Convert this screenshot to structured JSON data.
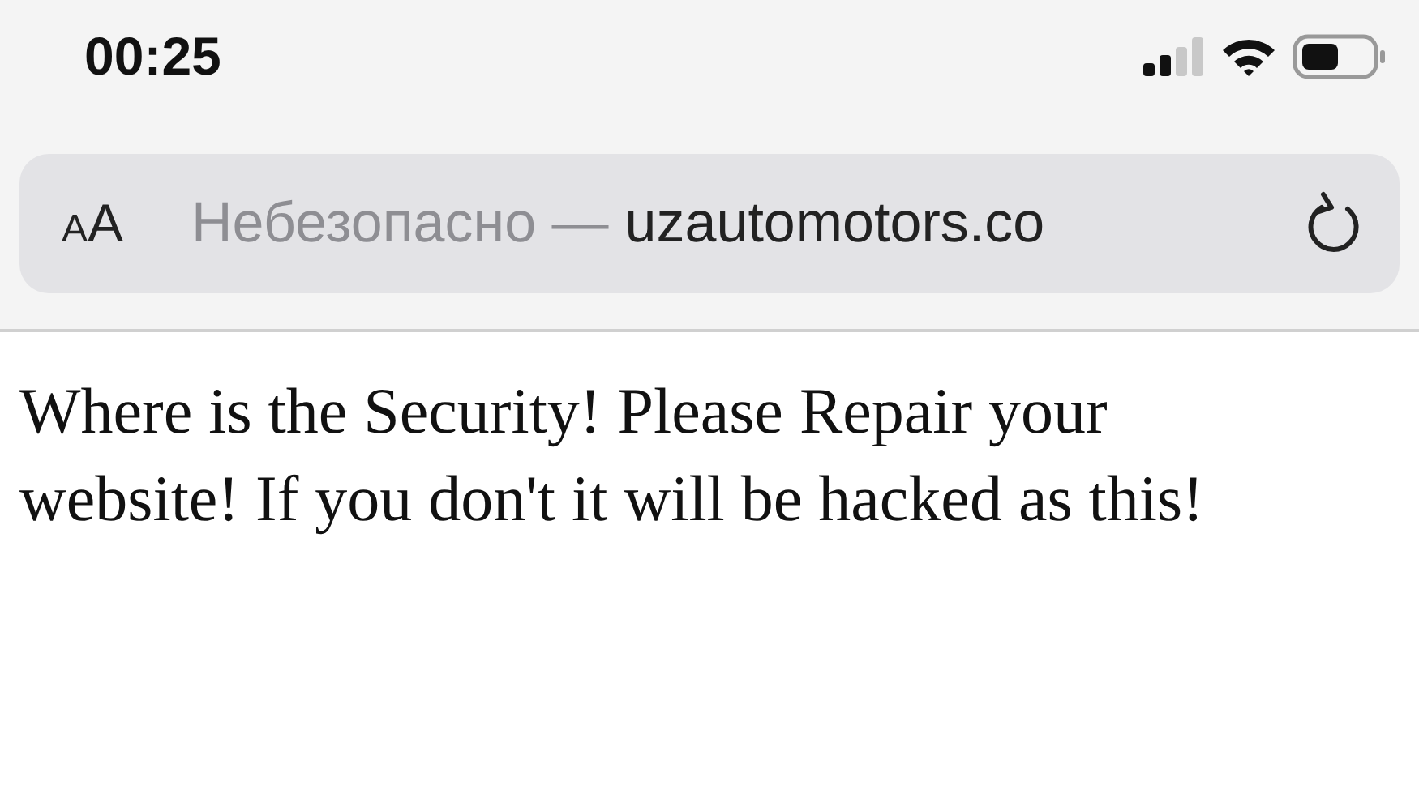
{
  "status_bar": {
    "time": "00:25"
  },
  "address_bar": {
    "text_size_button": "AA",
    "security_label": "Небезопасно —",
    "url": "uzautomotors.co"
  },
  "page": {
    "paragraph": "Where is the Security! Please Repair your website! If you don't it will be hacked as this!"
  }
}
